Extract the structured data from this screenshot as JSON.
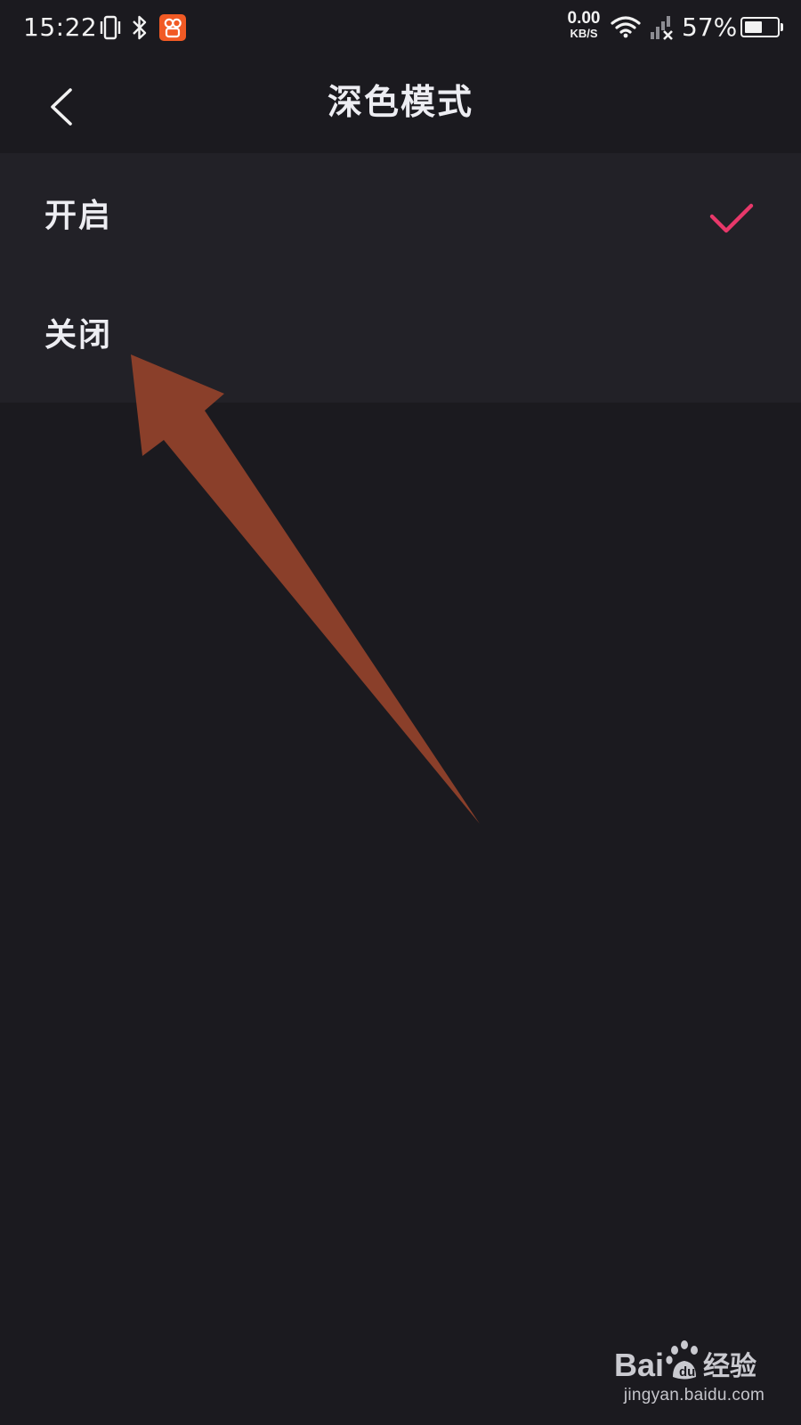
{
  "status_bar": {
    "time": "15:22",
    "net_speed_value": "0.00",
    "net_speed_unit": "KB/S",
    "battery_percent": "57%",
    "battery_level": 0.57,
    "icons": [
      "vibrate-icon",
      "bluetooth-icon",
      "app-badge-icon",
      "wifi-icon",
      "signal-off-icon",
      "battery-icon"
    ]
  },
  "header": {
    "title": "深色模式",
    "back_icon": "chevron-left-icon"
  },
  "options": [
    {
      "label": "开启",
      "selected": true
    },
    {
      "label": "关闭",
      "selected": false
    }
  ],
  "colors": {
    "background": "#1b1a1f",
    "list_background": "#222127",
    "check_accent": "#e8386a",
    "annotation_arrow": "#8a3f2a",
    "app_badge": "#f15a24"
  },
  "watermark": {
    "logo_text": "Baidu经验",
    "domain": "jingyan.baidu.com"
  }
}
